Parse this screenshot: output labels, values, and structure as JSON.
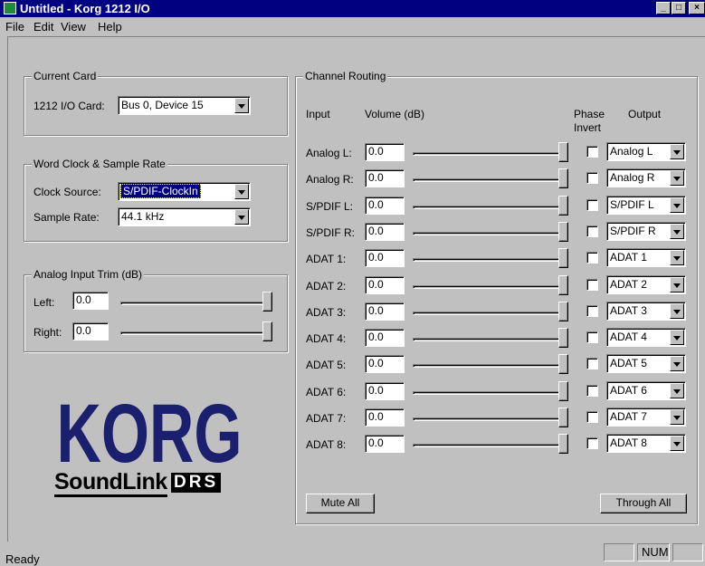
{
  "window": {
    "title": "Untitled - Korg 1212 I/O"
  },
  "menu": [
    "File",
    "Edit",
    "View",
    "Help"
  ],
  "current_card": {
    "group_label": "Current Card",
    "card_label": "1212 I/O Card:",
    "card_value": "Bus 0, Device 15"
  },
  "word_clock": {
    "group_label": "Word Clock & Sample Rate",
    "clock_source_label": "Clock Source:",
    "clock_source_value": "S/PDIF-ClockIn",
    "sample_rate_label": "Sample Rate:",
    "sample_rate_value": "44.1 kHz"
  },
  "analog_trim": {
    "group_label": "Analog Input Trim (dB)",
    "left_label": "Left:",
    "left_value": "0.0",
    "left_level": 1.0,
    "right_label": "Right:",
    "right_value": "0.0",
    "right_level": 1.0
  },
  "logo": {
    "brand": "KORG",
    "product": "SoundLink",
    "product_suffix": "DRS"
  },
  "routing": {
    "group_label": "Channel Routing",
    "col_input": "Input",
    "col_volume": "Volume (dB)",
    "col_phase": "Phase Invert",
    "col_output": "Output",
    "channels": [
      {
        "input": "Analog L:",
        "volume": "0.0",
        "level": 1.0,
        "phase_invert": false,
        "output": "Analog L"
      },
      {
        "input": "Analog R:",
        "volume": "0.0",
        "level": 1.0,
        "phase_invert": false,
        "output": "Analog R"
      },
      {
        "input": "S/PDIF L:",
        "volume": "0.0",
        "level": 1.0,
        "phase_invert": false,
        "output": "S/PDIF L"
      },
      {
        "input": "S/PDIF R:",
        "volume": "0.0",
        "level": 1.0,
        "phase_invert": false,
        "output": "S/PDIF R"
      },
      {
        "input": "ADAT 1:",
        "volume": "0.0",
        "level": 1.0,
        "phase_invert": false,
        "output": "ADAT 1"
      },
      {
        "input": "ADAT 2:",
        "volume": "0.0",
        "level": 1.0,
        "phase_invert": false,
        "output": "ADAT 2"
      },
      {
        "input": "ADAT 3:",
        "volume": "0.0",
        "level": 1.0,
        "phase_invert": false,
        "output": "ADAT 3"
      },
      {
        "input": "ADAT 4:",
        "volume": "0.0",
        "level": 1.0,
        "phase_invert": false,
        "output": "ADAT 4"
      },
      {
        "input": "ADAT 5:",
        "volume": "0.0",
        "level": 1.0,
        "phase_invert": false,
        "output": "ADAT 5"
      },
      {
        "input": "ADAT 6:",
        "volume": "0.0",
        "level": 1.0,
        "phase_invert": false,
        "output": "ADAT 6"
      },
      {
        "input": "ADAT 7:",
        "volume": "0.0",
        "level": 1.0,
        "phase_invert": false,
        "output": "ADAT 7"
      },
      {
        "input": "ADAT 8:",
        "volume": "0.0",
        "level": 1.0,
        "phase_invert": false,
        "output": "ADAT 8"
      }
    ],
    "mute_all_label": "Mute All",
    "through_all_label": "Through All"
  },
  "status": {
    "text": "Ready",
    "num": "NUM"
  },
  "colors": {
    "titlebar": "#000080",
    "face": "#c0c0c0",
    "logo": "#1a1f6e"
  }
}
